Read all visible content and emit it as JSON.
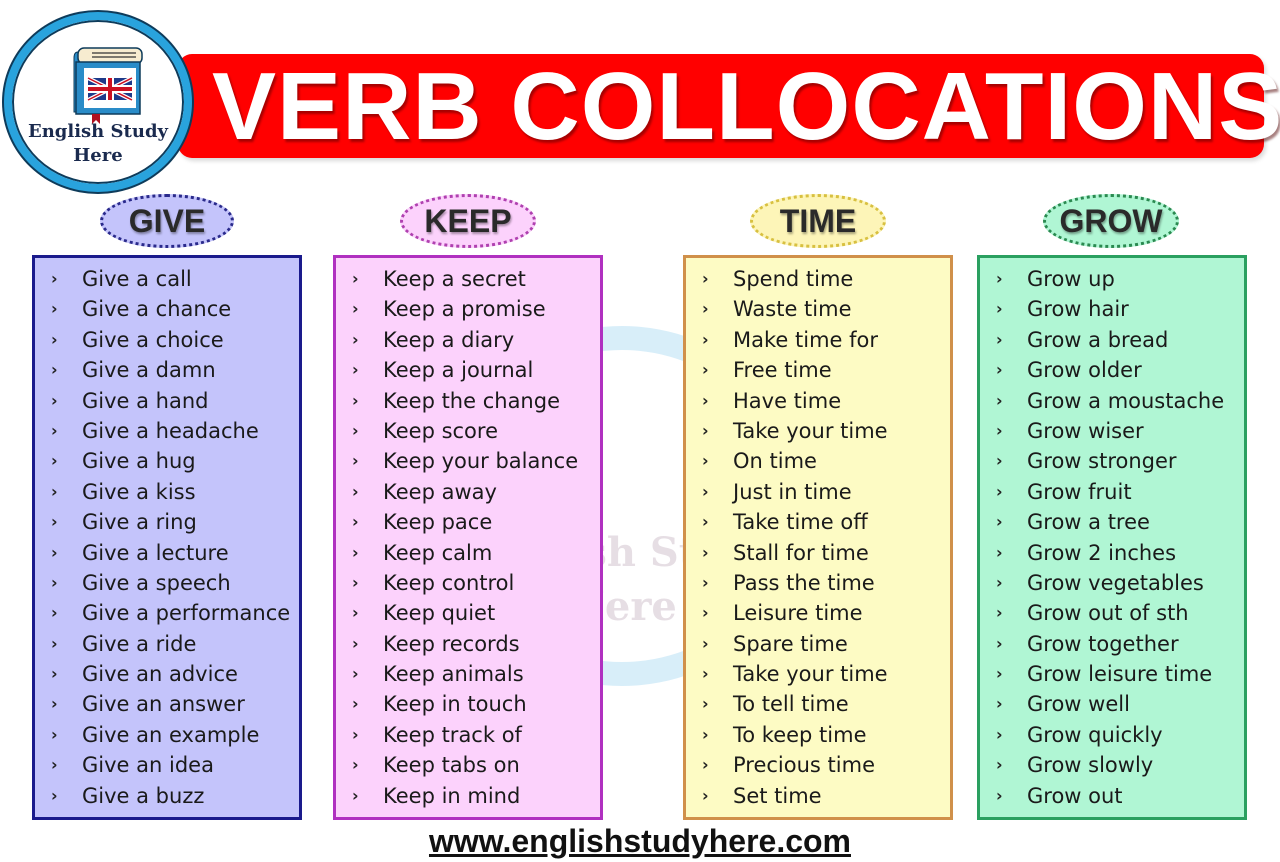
{
  "header": {
    "title": "VERB COLLOCATIONS",
    "banner_color": "#ff0000"
  },
  "logo": {
    "line1": "English Study",
    "line2": "Here",
    "icon": "book-with-union-jack-icon",
    "ring_color": "#29a3dd"
  },
  "watermark": {
    "line1": "English Study",
    "line2": "Here"
  },
  "columns": [
    {
      "heading": "GIVE",
      "fill": "#c4c4fb",
      "border": "#1a1a8c",
      "pill_fill": "#c4c4fb",
      "pill_border": "#2a2a8c",
      "items": [
        "Give a call",
        "Give a chance",
        "Give a choice",
        "Give a damn",
        "Give a hand",
        "Give a headache",
        "Give a hug",
        "Give a kiss",
        "Give a ring",
        "Give a lecture",
        "Give a speech",
        "Give a performance",
        "Give a ride",
        "Give an advice",
        "Give an answer",
        "Give an example",
        "Give an idea",
        "Give a buzz"
      ]
    },
    {
      "heading": "KEEP",
      "fill": "#fcd2fc",
      "border": "#b030c0",
      "pill_fill": "#fcd2fc",
      "pill_border": "#b040b0",
      "items": [
        "Keep a secret",
        "Keep a promise",
        "Keep a diary",
        "Keep a journal",
        "Keep the change",
        "Keep score",
        "Keep your balance",
        "Keep away",
        "Keep pace",
        "Keep calm",
        "Keep control",
        "Keep quiet",
        "Keep records",
        "Keep animals",
        "Keep in touch",
        "Keep track of",
        "Keep tabs on",
        "Keep in mind"
      ]
    },
    {
      "heading": "TIME",
      "fill": "#fdfbc4",
      "border": "#d0904a",
      "pill_fill": "#fdf5b8",
      "pill_border": "#d8c040",
      "items": [
        "Spend time",
        "Waste time",
        "Make time for",
        "Free time",
        "Have time",
        "Take your time",
        "On time",
        "Just in time",
        "Take time off",
        "Stall for time",
        "Pass the time",
        "Leisure time",
        "Spare time",
        "Take your time",
        "To tell time",
        "To keep time",
        "Precious time",
        "Set time"
      ]
    },
    {
      "heading": "GROW",
      "fill": "#b0f6d4",
      "border": "#2aa060",
      "pill_fill": "#b0f6d4",
      "pill_border": "#2a8a50",
      "items": [
        "Grow up",
        "Grow hair",
        "Grow a bread",
        "Grow older",
        "Grow a moustache",
        "Grow wiser",
        "Grow stronger",
        "Grow fruit",
        "Grow a tree",
        "Grow 2 inches",
        "Grow vegetables",
        "Grow out of sth",
        "Grow together",
        "Grow leisure time",
        "Grow well",
        "Grow quickly",
        "Grow slowly",
        "Grow out"
      ]
    }
  ],
  "bullet_glyph": "›",
  "footer": {
    "url": "www.englishstudyhere.com"
  }
}
